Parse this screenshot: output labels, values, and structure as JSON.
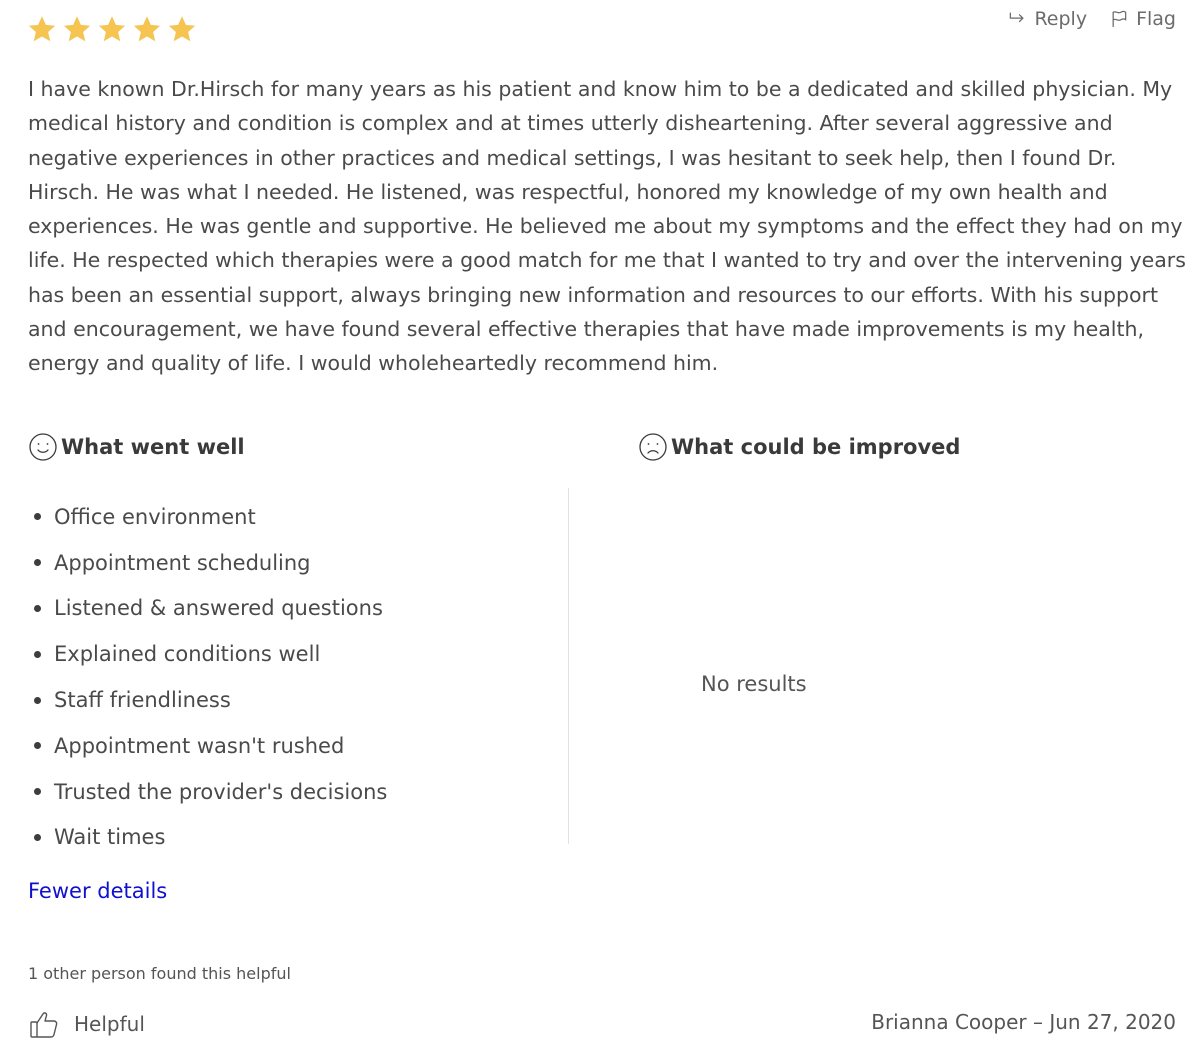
{
  "rating": {
    "stars": 5,
    "max": 5,
    "color": "#f5c451"
  },
  "actions": {
    "reply_label": "Reply",
    "flag_label": "Flag"
  },
  "review": {
    "text": "I have known Dr.Hirsch for many years as his patient and know him to be a dedicated and skilled physician. My medical history and condition is complex and at times utterly disheartening. After several aggressive and negative experiences in other practices and medical settings, I was hesitant to seek help, then I found Dr. Hirsch. He was what I needed. He listened, was respectful, honored my knowledge of my own health and experiences. He was gentle and supportive. He believed me about my symptoms and the effect they had on my life. He respected which therapies were a good match for me that I wanted to try and over the intervening years has been an essential support, always bringing new information and resources to our efforts. With his support and encouragement, we have found several effective therapies that have made improvements is my health, energy and quality of life. I would wholeheartedly recommend him."
  },
  "went_well": {
    "title": "What went well",
    "icon": "smile-icon",
    "items": [
      "Office environment",
      "Appointment scheduling",
      "Listened & answered questions",
      "Explained conditions well",
      "Staff friendliness",
      "Appointment wasn't rushed",
      "Trusted the provider's decisions",
      "Wait times"
    ]
  },
  "could_improve": {
    "title": "What could be improved",
    "icon": "frown-icon",
    "empty_text": "No results"
  },
  "fewer_details_label": "Fewer details",
  "helpful": {
    "count_text": "1 other person found this helpful",
    "button_label": "Helpful"
  },
  "author_date": "Brianna Cooper – Jun 27, 2020",
  "colors": {
    "link": "#1010d0",
    "star": "#f5c451",
    "text": "#4a4a4a"
  }
}
